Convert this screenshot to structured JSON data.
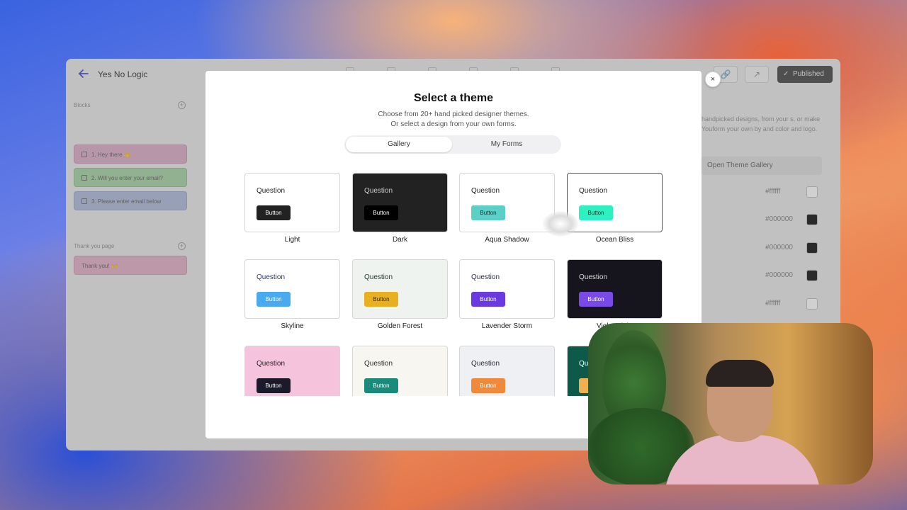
{
  "app": {
    "title": "Yes No Logic",
    "published_label": "Published",
    "sections": {
      "blocks_label": "Blocks",
      "thankyou_label": "Thank you page"
    },
    "blocks": [
      {
        "label": "1. Hey there 👋"
      },
      {
        "label": "2. Will you enter your email?"
      },
      {
        "label": "3. Please enter email below"
      }
    ],
    "thankyou_items": [
      {
        "label": "Thank you! 🙌"
      }
    ],
    "right_panel": {
      "description": "handpicked designs, from your s, or make Youform your own by and color and logo.",
      "open_gallery_label": "Open Theme Gallery",
      "colors": [
        {
          "hex": "#ffffff",
          "swatch": "#ffffff"
        },
        {
          "hex": "#000000",
          "swatch": "#000000"
        },
        {
          "hex": "#000000",
          "swatch": "#000000"
        },
        {
          "hex": "#000000",
          "swatch": "#000000"
        },
        {
          "hex": "#ffffff",
          "swatch": "#ffffff"
        }
      ]
    }
  },
  "modal": {
    "title": "Select a theme",
    "subtitle_line1": "Choose from 20+ hand picked designer themes.",
    "subtitle_line2": "Or select a design from your own forms.",
    "tabs": [
      {
        "label": "Gallery",
        "active": true
      },
      {
        "label": "My Forms",
        "active": false
      }
    ],
    "close_label": "×",
    "themes": [
      {
        "name": "Light",
        "question": "Question",
        "button": "Button",
        "bg": "#ffffff",
        "text": "#222222",
        "btn_bg": "#222222",
        "btn_text": "#ffffff"
      },
      {
        "name": "Dark",
        "question": "Question",
        "button": "Button",
        "bg": "#222222",
        "text": "#cccccc",
        "btn_bg": "#000000",
        "btn_text": "#ffffff"
      },
      {
        "name": "Aqua Shadow",
        "question": "Question",
        "button": "Button",
        "bg": "#ffffff",
        "text": "#222222",
        "btn_bg": "#5ccfc7",
        "btn_text": "#0e3b38"
      },
      {
        "name": "Ocean Bliss",
        "question": "Question",
        "button": "Button",
        "bg": "#ffffff",
        "text": "#222222",
        "btn_bg": "#2ff0c0",
        "btn_text": "#0e3b30"
      },
      {
        "name": "Skyline",
        "question": "Question",
        "button": "Button",
        "bg": "#ffffff",
        "text": "#2a3a6a",
        "btn_bg": "#4aaaf0",
        "btn_text": "#ffffff"
      },
      {
        "name": "Golden Forest",
        "question": "Question",
        "button": "Button",
        "bg": "#eef3f0",
        "text": "#2a3a2a",
        "btn_bg": "#e8b020",
        "btn_text": "#3a2a00"
      },
      {
        "name": "Lavender Storm",
        "question": "Question",
        "button": "Button",
        "bg": "#ffffff",
        "text": "#2a2a4a",
        "btn_bg": "#6a3ae0",
        "btn_text": "#ffffff"
      },
      {
        "name": "Violet Night",
        "question": "Question",
        "button": "Button",
        "bg": "#16141c",
        "text": "#dddddd",
        "btn_bg": "#7a4ae8",
        "btn_text": "#ffffff"
      },
      {
        "name": "",
        "question": "Question",
        "button": "Button",
        "bg": "#f6c3dc",
        "text": "#222222",
        "btn_bg": "#1a1a2a",
        "btn_text": "#ffffff"
      },
      {
        "name": "",
        "question": "Question",
        "button": "Button",
        "bg": "#f7f6f0",
        "text": "#2a2a2a",
        "btn_bg": "#1a8a7a",
        "btn_text": "#ffffff"
      },
      {
        "name": "",
        "question": "Question",
        "button": "Button",
        "bg": "#eef0f4",
        "text": "#2a2a3a",
        "btn_bg": "#f08a3a",
        "btn_text": "#ffffff"
      },
      {
        "name": "",
        "question": "Question",
        "button": "Button",
        "bg": "#0e5a4a",
        "text": "#ffffff",
        "btn_bg": "#f0b050",
        "btn_text": "#2a1a00"
      }
    ]
  }
}
